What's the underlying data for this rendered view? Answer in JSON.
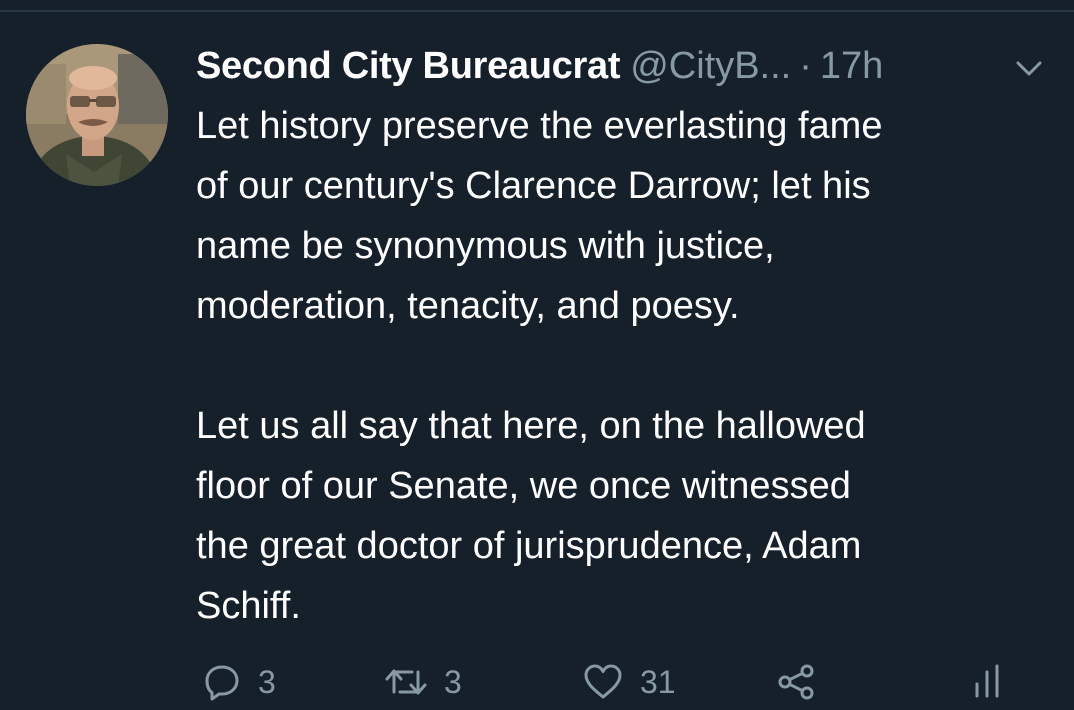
{
  "tweet": {
    "author_name": "Second City Bureaucrat",
    "handle": "@CityB...",
    "separator": "·",
    "time": "17h",
    "paragraphs": [
      "Let history preserve the everlasting fame\nof our century's Clarence Darrow; let his\nname be synonymous with justice,\nmoderation, tenacity, and poesy.",
      "Let us all say that here, on the hallowed\nfloor of our Senate, we once witnessed\nthe great doctor of jurisprudence, Adam\nSchiff."
    ]
  },
  "actions": {
    "reply_count": "3",
    "retweet_count": "3",
    "like_count": "31"
  },
  "icons": {
    "menu": "chevron-down-icon",
    "reply": "reply-icon",
    "retweet": "retweet-icon",
    "like": "heart-icon",
    "share": "share-icon",
    "analytics": "analytics-icon"
  },
  "colors": {
    "background": "#16202b",
    "text_primary": "#ffffff",
    "text_secondary": "#8899a6",
    "divider": "#263646"
  }
}
